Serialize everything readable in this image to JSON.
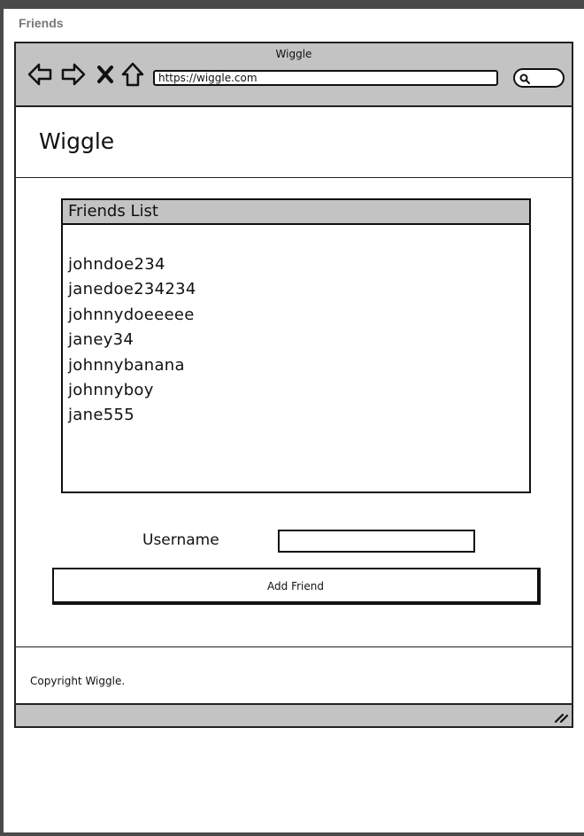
{
  "page": {
    "title": "Friends"
  },
  "browser": {
    "window_title": "Wiggle",
    "url": "https://wiggle.com",
    "nav_icons": [
      "back-arrow-icon",
      "forward-arrow-icon",
      "close-icon",
      "home-icon"
    ],
    "search_icon": "search-icon"
  },
  "site": {
    "title": "Wiggle"
  },
  "friends_panel": {
    "header": "Friends List",
    "friends": [
      "johndoe234",
      "janedoe234234",
      "johnnydoeeeee",
      "janey34",
      "johnnybanana",
      "johnnyboy",
      "jane555"
    ]
  },
  "form": {
    "username_label": "Username",
    "username_value": "",
    "add_button_label": "Add Friend"
  },
  "footer": {
    "copyright": "Copyright Wiggle."
  },
  "colors": {
    "chrome": "#c3c3c3",
    "ink": "#111111"
  }
}
